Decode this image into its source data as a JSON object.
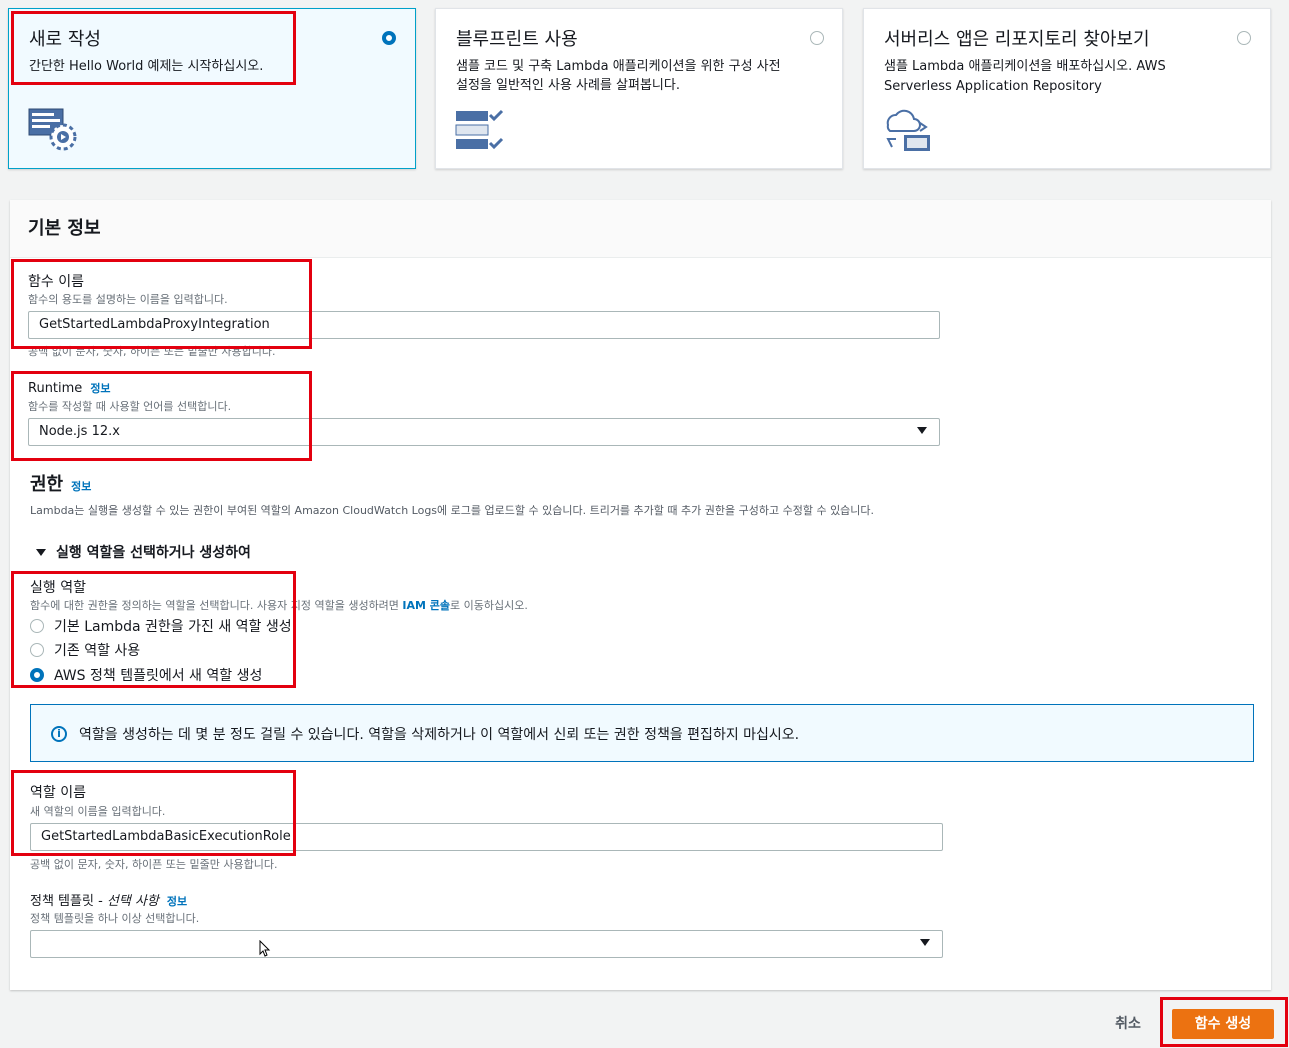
{
  "options": [
    {
      "title": "새로 작성",
      "desc": "간단한 Hello World 예제는 시작하십시오.",
      "icon": "code-gear-icon",
      "selected": true
    },
    {
      "title": "블루프린트 사용",
      "desc1": "샘플 코드 및 구축 Lambda 애플리케이션을 위한 구성 사전",
      "desc2": "설정을 일반적인 사용 사례를 살펴봅니다.",
      "icon": "checklist-icon",
      "selected": false
    },
    {
      "title": "서버리스 앱은 리포지토리 찾아보기",
      "desc1": "샘플 Lambda 애플리케이션을 배포하십시오. AWS",
      "desc2": "Serverless Application Repository",
      "icon": "cloud-deploy-icon",
      "selected": false
    }
  ],
  "basic": {
    "title": "기본 정보",
    "function_name": {
      "label": "함수 이름",
      "desc": "함수의 용도를 설명하는 이름을 입력합니다.",
      "value": "GetStartedLambdaProxyIntegration",
      "hint": "공백 없이 문자, 숫자, 하이픈 또는 밑줄만 사용합니다."
    },
    "runtime": {
      "label": "Runtime",
      "info": "정보",
      "desc": "함수를 작성할 때 사용할 언어를 선택합니다.",
      "value": "Node.js 12.x"
    }
  },
  "permissions": {
    "title": "권한",
    "info": "정보",
    "desc": "Lambda는 실행을 생성할 수 있는 권한이 부여된 역할의 Amazon CloudWatch Logs에 로그를 업로드할 수 있습니다. 트리거를 추가할 때 추가 권한을 구성하고 수정할 수 있습니다.",
    "expander": "실행 역할을 선택하거나 생성하여",
    "exec_role": {
      "label": "실행 역할",
      "desc_pre": "함수에 대한 권한을 정의하는 역할을 선택합니다. 사용자 지정 역할을 생성하려면 ",
      "desc_link": "IAM 콘솔",
      "desc_post": "로 이동하십시오.",
      "options": [
        "기본 Lambda 권한을 가진 새 역할 생성",
        "기존 역할 사용",
        "AWS 정책 템플릿에서 새 역할 생성"
      ],
      "selected_index": 2
    },
    "alert": "역할을 생성하는 데 몇 분 정도 걸릴 수 있습니다. 역할을 삭제하거나 이 역할에서 신뢰 또는 권한 정책을 편집하지 마십시오.",
    "role_name": {
      "label": "역할 이름",
      "desc": "새 역할의 이름을 입력합니다.",
      "value": "GetStartedLambdaBasicExecutionRole",
      "hint": "공백 없이 문자, 숫자, 하이픈 또는 밑줄만 사용합니다."
    },
    "policy": {
      "label": "정책 템플릿 - ",
      "label_optional": "선택 사항",
      "info": "정보",
      "desc": "정책 템플릿을 하나 이상 선택합니다.",
      "value": ""
    }
  },
  "footer": {
    "cancel": "취소",
    "create": "함수 생성"
  },
  "colors": {
    "accent": "#0073bb",
    "primary_button": "#ec7211",
    "highlight_box": "#e3000f"
  }
}
